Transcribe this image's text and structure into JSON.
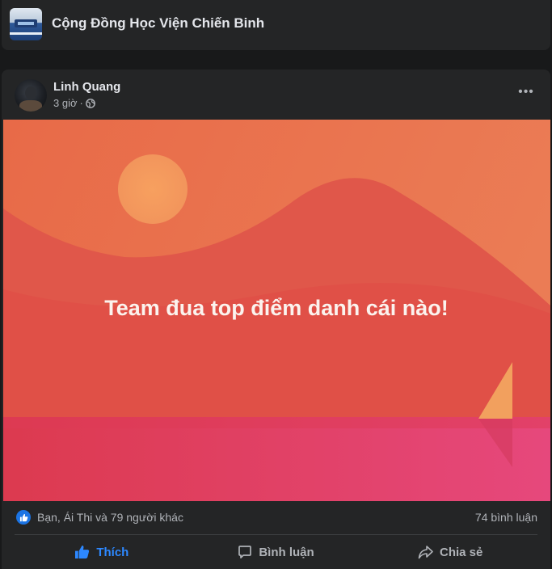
{
  "group": {
    "name": "Cộng Đồng Học Viện Chiến Binh"
  },
  "post": {
    "author": "Linh Quang",
    "time": "3 giờ",
    "separator": "·",
    "text": "Team đua top điểm danh cái nào!",
    "reactions_text": "Bạn, Ái Thi và 79 người khác",
    "comments_text": "74 bình luận",
    "more_label": "•••"
  },
  "actions": {
    "like": "Thích",
    "comment": "Bình luận",
    "share": "Chia sẻ"
  },
  "colors": {
    "accent": "#2d88ff",
    "background": "#18191a",
    "card": "#242526",
    "image_top": "#e8704c",
    "image_bottom": "#e6487a"
  },
  "icons": [
    "group-avatar",
    "author-avatar",
    "globe-icon",
    "more-icon",
    "like-badge-icon",
    "thumbs-up-icon",
    "comment-icon",
    "share-icon"
  ]
}
